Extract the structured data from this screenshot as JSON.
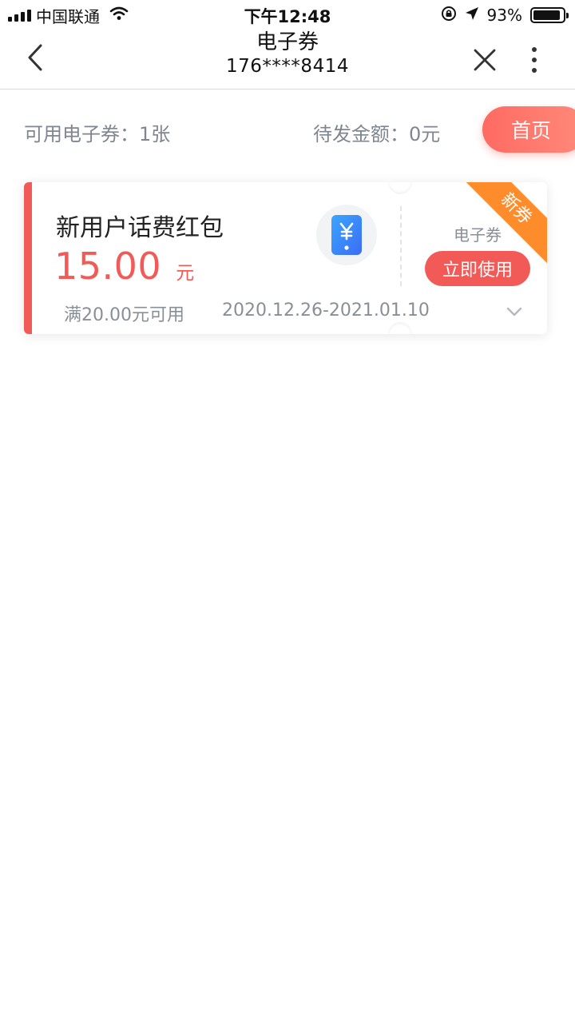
{
  "status_bar": {
    "carrier": "中国联通",
    "time": "下午12:48",
    "battery_percent": "93%",
    "battery_level": 0.93
  },
  "nav": {
    "title": "电子券",
    "subtitle": "176****8414",
    "back_icon": "chevron-left-icon",
    "close_icon": "close-icon",
    "more_icon": "more-vertical-icon"
  },
  "summary": {
    "available": "可用电子券：1张",
    "pending": "待发金额：0元",
    "home_label": "首页"
  },
  "coupon": {
    "title": "新用户话费红包",
    "amount": "15.00",
    "unit": "元",
    "type_label": "电子券",
    "use_label": "立即使用",
    "badge": "新券",
    "condition": "满20.00元可用",
    "validity": "2020.12.26-2021.01.10",
    "icon": "phone-yuan-icon"
  },
  "colors": {
    "accent_red": "#f25a57",
    "badge_orange": "#ff8c2a",
    "muted_text": "#8a8f97"
  }
}
